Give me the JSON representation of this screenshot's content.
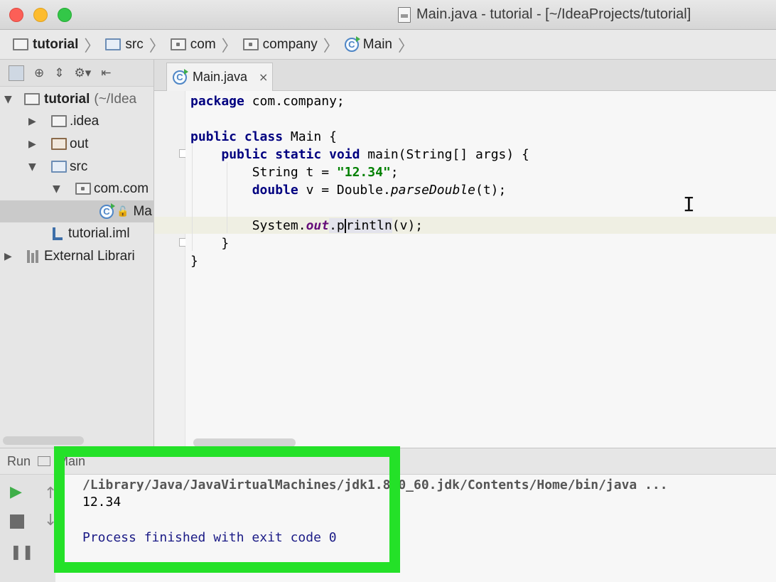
{
  "window": {
    "title": "Main.java - tutorial - [~/IdeaProjects/tutorial]"
  },
  "breadcrumbs": [
    "tutorial",
    "src",
    "com",
    "company",
    "Main"
  ],
  "project_tree": {
    "root_label": "tutorial",
    "root_path": "(~/Idea",
    "idea": ".idea",
    "out": "out",
    "src": "src",
    "package": "com.com",
    "main_class": "Ma",
    "iml": "tutorial.iml",
    "external": "External Librari"
  },
  "editor": {
    "tab_label": "Main.java",
    "tab_close": "×",
    "code": {
      "l1_kw": "package",
      "l1_rest": " com.company;",
      "l3_kw1": "public",
      "l3_kw2": "class",
      "l3_rest": " Main {",
      "l4_kw1": "public",
      "l4_kw2": "static",
      "l4_kw3": "void",
      "l4_rest": " main(String[] args) {",
      "l5_a": "String t = ",
      "l5_str": "\"12.34\"",
      "l5_b": ";",
      "l6_kw": "double",
      "l6_a": " v = Double.",
      "l6_it": "parseDouble",
      "l6_b": "(t);",
      "l8_a": "System.",
      "l8_field": "out",
      "l8_b": ".p",
      "l8_c": "rintln",
      "l8_d": "(v);",
      "l9": "}",
      "l10": "}"
    }
  },
  "run": {
    "panel_label": "Run",
    "config_label": "Main",
    "command": "/Library/Java/JavaVirtualMachines/jdk1.8.0_60.jdk/Contents/Home/bin/java ...",
    "output": "12.34",
    "finished": "Process finished with exit code 0"
  },
  "colors": {
    "highlight_frame": "#24e128",
    "keyword": "#000080",
    "string": "#008000"
  }
}
